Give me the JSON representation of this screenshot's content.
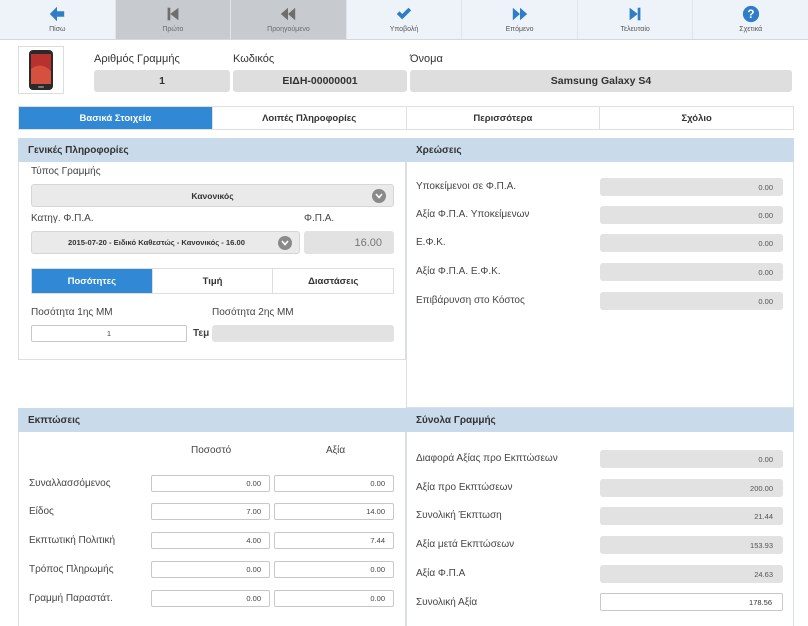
{
  "toolbar": {
    "back": "Πίσω",
    "first": "Πρώτο",
    "previous": "Προηγούμενο",
    "submit": "Υποβολή",
    "next": "Επόμενο",
    "last": "Τελευταίο",
    "about": "Σχετικά"
  },
  "header": {
    "line_no_label": "Αριθμός Γραμμής",
    "line_no": "1",
    "code_label": "Κωδικός",
    "code": "ΕΙΔΗ-00000001",
    "name_label": "Όνομα",
    "name": "Samsung Galaxy S4"
  },
  "tabs": [
    "Βασικά Στοιχεία",
    "Λοιπές Πληροφορίες",
    "Περισσότερα",
    "Σχόλιο"
  ],
  "general": {
    "title": "Γενικές Πληροφορίες",
    "line_type_label": "Τύπος Γραμμής",
    "line_type": "Κανονικός",
    "vat_cat_label": "Κατηγ. Φ.Π.Α.",
    "vat_cat": "2015-07-20 - Ειδικό Καθεστώς - Κανονικός - 16.00",
    "vat_label": "Φ.Π.Α.",
    "vat": "16.00",
    "subtabs": [
      "Ποσότητες",
      "Τιμή",
      "Διαστάσεις"
    ],
    "qty1_label": "Ποσότητα 1ης ΜΜ",
    "qty1": "1",
    "qty1_unit": "Τεμ",
    "qty2_label": "Ποσότητα 2ης ΜΜ",
    "qty2": ""
  },
  "charges": {
    "title": "Χρεώσεις",
    "rows": [
      {
        "label": "Υποκείμενοι σε Φ.Π.Α.",
        "value": "0.00"
      },
      {
        "label": "Αξία Φ.Π.Α. Υποκείμενων",
        "value": "0.00"
      },
      {
        "label": "Ε.Φ.Κ.",
        "value": "0.00"
      },
      {
        "label": "Αξία Φ.Π.Α. Ε.Φ.Κ.",
        "value": "0.00"
      },
      {
        "label": "Επιβάρυνση στο Κόστος",
        "value": "0.00"
      }
    ]
  },
  "discounts": {
    "title": "Εκπτώσεις",
    "col_percent": "Ποσοστό",
    "col_value": "Αξία",
    "rows": [
      {
        "label": "Συναλλασσόμενος",
        "percent": "0.00",
        "value": "0.00"
      },
      {
        "label": "Είδος",
        "percent": "7.00",
        "value": "14.00"
      },
      {
        "label": "Εκπτωτική Πολιτική",
        "percent": "4.00",
        "value": "7.44"
      },
      {
        "label": "Τρόπος Πληρωμής",
        "percent": "0.00",
        "value": "0.00"
      },
      {
        "label": "Γραμμή Παραστάτ.",
        "percent": "0.00",
        "value": "0.00"
      }
    ]
  },
  "totals": {
    "title": "Σύνολα Γραμμής",
    "rows": [
      {
        "label": "Διαφορά Αξίας προ Εκπτώσεων",
        "value": "0.00"
      },
      {
        "label": "Αξία προ Εκπτώσεων",
        "value": "200.00"
      },
      {
        "label": "Συνολική Έκπτωση",
        "value": "21.44"
      },
      {
        "label": "Αξία μετά Εκπτώσεων",
        "value": "153.93"
      },
      {
        "label": "Αξία Φ.Π.Α",
        "value": "24.63"
      },
      {
        "label": "Συνολική Αξία",
        "value": "178.56"
      }
    ]
  },
  "colors": {
    "accent": "#3188d4",
    "panel_header": "#c9dbeb",
    "toolbar_light": "#eef3f9",
    "toolbar_dark": "#c7cbd0"
  }
}
